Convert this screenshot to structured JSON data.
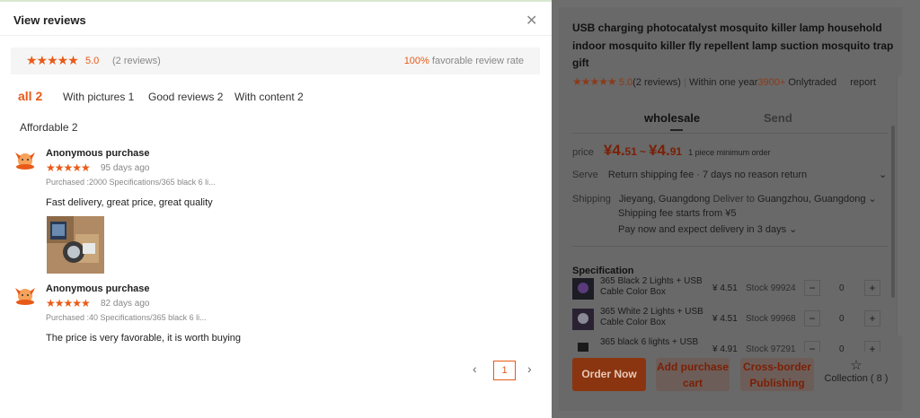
{
  "reviews_panel": {
    "title": "View reviews",
    "close_icon": "close-icon",
    "summary": {
      "stars": "★★★★★",
      "score": "5.0",
      "count": "(2 reviews)",
      "rate_pct": "100%",
      "rate_label": "favorable review rate"
    },
    "filters": [
      "all 2",
      "With pictures 1",
      "Good reviews 2",
      "With content 2",
      "Affordable 2"
    ],
    "reviews": [
      {
        "name": "Anonymous purchase",
        "stars": "★★★★★",
        "days": "95 days ago",
        "spec": "Purchased :2000 Specifications/365 black 6 li...",
        "text": "Fast delivery, great price, great quality"
      },
      {
        "name": "Anonymous purchase",
        "stars": "★★★★★",
        "days": "82 days ago",
        "spec": "Purchased :40 Specifications/365 black 6 li...",
        "text": "The price is very favorable, it is worth buying"
      }
    ],
    "pagination": {
      "prev": "‹",
      "page": "1",
      "next": "›"
    },
    "accent": "#e85a17"
  },
  "product": {
    "title": "USB charging photocatalyst mosquito killer lamp household indoor mosquito killer fly repellent lamp suction mosquito trap gift",
    "stars": "★★★★★",
    "score": "5.0",
    "reviews": "(2 reviews)",
    "within": "Within one year",
    "traded_count": "3900+",
    "traded_label": "Onlytraded",
    "report": "report",
    "tabs": [
      "wholesale",
      "Send"
    ],
    "price_label": "price",
    "price_low_int": "¥4.",
    "price_low_dec": "51",
    "price_sep": "~",
    "price_high_int": "¥4.",
    "price_high_dec": "91",
    "min_order": "1 piece minimum order",
    "serve_label": "Serve",
    "serve_value": "Return shipping fee · 7 days no reason return",
    "shipping_label": "Shipping",
    "ship_from": "Jieyang, Guangdong",
    "deliver_to_label": "Deliver to",
    "deliver_to": "Guangzhou, Guangdong",
    "ship_fee": "Shipping fee starts from ¥5",
    "pay_delivery": "Pay now and expect delivery in 3 days",
    "spec_title": "Specification",
    "specs": [
      {
        "name": "365 Black 2 Lights + USB Cable Color Box",
        "price": "¥ 4.51",
        "stock": "Stock 99924",
        "qty": "0"
      },
      {
        "name": "365 White 2 Lights + USB Cable Color Box",
        "price": "¥ 4.51",
        "stock": "Stock 99968",
        "qty": "0"
      },
      {
        "name": "365 black 6 lights + USB",
        "price": "¥ 4.91",
        "stock": "Stock 97291",
        "qty": "0"
      }
    ],
    "buttons": {
      "order": "Order Now",
      "cart_1": "Add purchase",
      "cart_2": "cart",
      "cross_1": "Cross-border",
      "cross_2": "Publishing",
      "collection": "Collection ( 8 )"
    }
  }
}
